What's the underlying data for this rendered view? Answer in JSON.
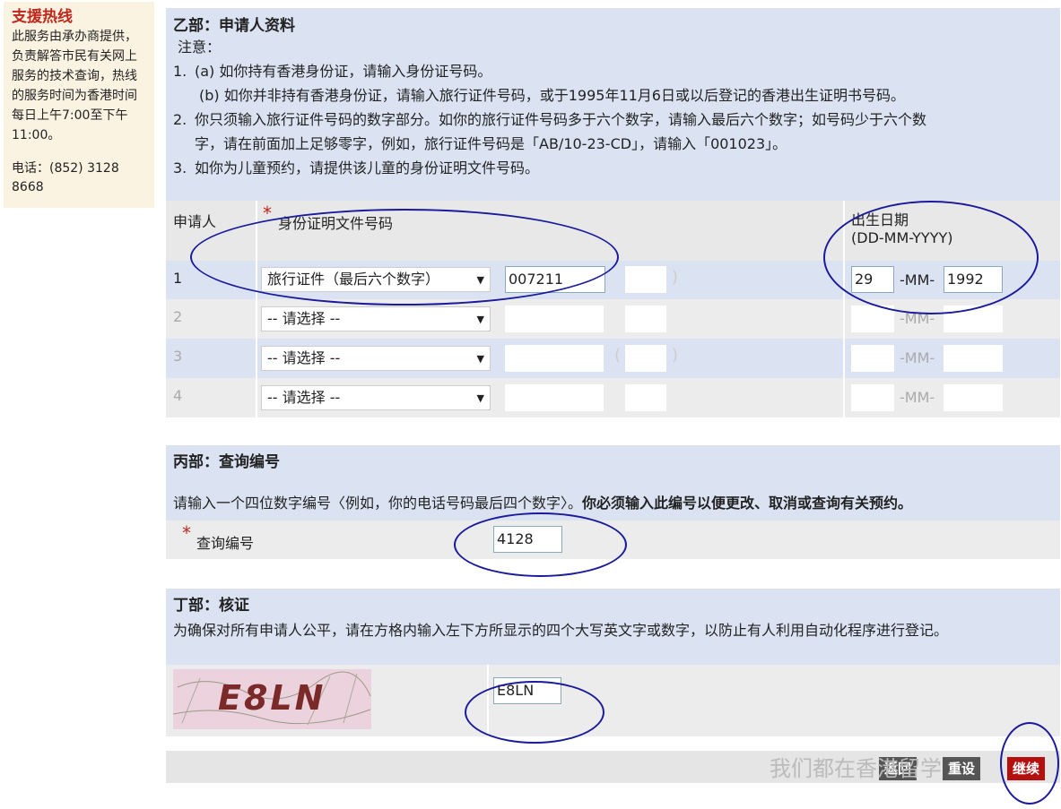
{
  "sidebar": {
    "title": "支援热线",
    "description": "此服务由承办商提供，负责解答市民有关网上服务的技术查询，热线的服务时间为香港时间每日上午7:00至下午11:00。",
    "phone": "电话：(852) 3128 8668"
  },
  "sectionB": {
    "title": "乙部：申请人资料",
    "note_label": "注意：",
    "note1_num": "1.",
    "note1a": "(a) 如你持有香港身份证，请输入身份证号码。",
    "note1b": "(b) 如你并非持有香港身份证，请输入旅行证件号码，或于1995年11月6日或以后登记的香港出生证明书号码。",
    "note2_num": "2.",
    "note2_line1": "你只须输入旅行证件号码的数字部分。如你的旅行证件号码多于六个数字，请输入最后六个数字；如号码少于六个数",
    "note2_line2": "字，请在前面加上足够零字，例如，旅行证件号码是「AB/10-23-CD」，请输入「001023」。",
    "note3_num": "3.",
    "note3": "如你为儿童预约，请提供该儿童的身份证明文件号码。",
    "table": {
      "col_applicant": "申请人",
      "col_id": "身份证明文件号码",
      "col_dob": "出生日期",
      "col_dob_format": "(DD-MM-YYYY)",
      "required_mark": "*",
      "rows": [
        {
          "num": "1",
          "doc_type": "旅行证件（最后六个数字）",
          "id_number": "007211",
          "check_digit": "",
          "day": "29",
          "mm": "-MM-",
          "year": "1992"
        },
        {
          "num": "2",
          "doc_type": "-- 请选择 --",
          "id_number": "",
          "check_digit": "",
          "day": "",
          "mm": "-MM-",
          "year": ""
        },
        {
          "num": "3",
          "doc_type": "-- 请选择 --",
          "id_number": "",
          "check_digit": "",
          "day": "",
          "mm": "-MM-",
          "year": ""
        },
        {
          "num": "4",
          "doc_type": "-- 请选择 --",
          "id_number": "",
          "check_digit": "",
          "day": "",
          "mm": "-MM-",
          "year": ""
        }
      ],
      "paren_open": "(",
      "paren_close": ")"
    }
  },
  "sectionC": {
    "title": "丙部：查询编号",
    "instruction": "请输入一个四位数字编号〈例如，你的电话号码最后四个数字〉。",
    "instruction_bold": "你必须输入此编号以便更改、取消或查询有关预约。",
    "field_label": "查询编号",
    "field_value": "4128",
    "required_mark": "*"
  },
  "sectionD": {
    "title": "丁部：核证",
    "instruction": "为确保对所有申请人公平，请在方格内输入左下方所显示的四个大写英文字或数字，以防止有人利用自动化程序进行登记。",
    "captcha_text": "E8LN",
    "captcha_input": "E8LN"
  },
  "footer": {
    "back_label": "返回",
    "reset_label": "重设",
    "continue_label": "继续",
    "watermark": "我们都在香港留学"
  },
  "colors": {
    "accent_red": "#c0271c",
    "header_blue": "#dbe3f3",
    "annotation_blue": "#1a1a9c"
  }
}
